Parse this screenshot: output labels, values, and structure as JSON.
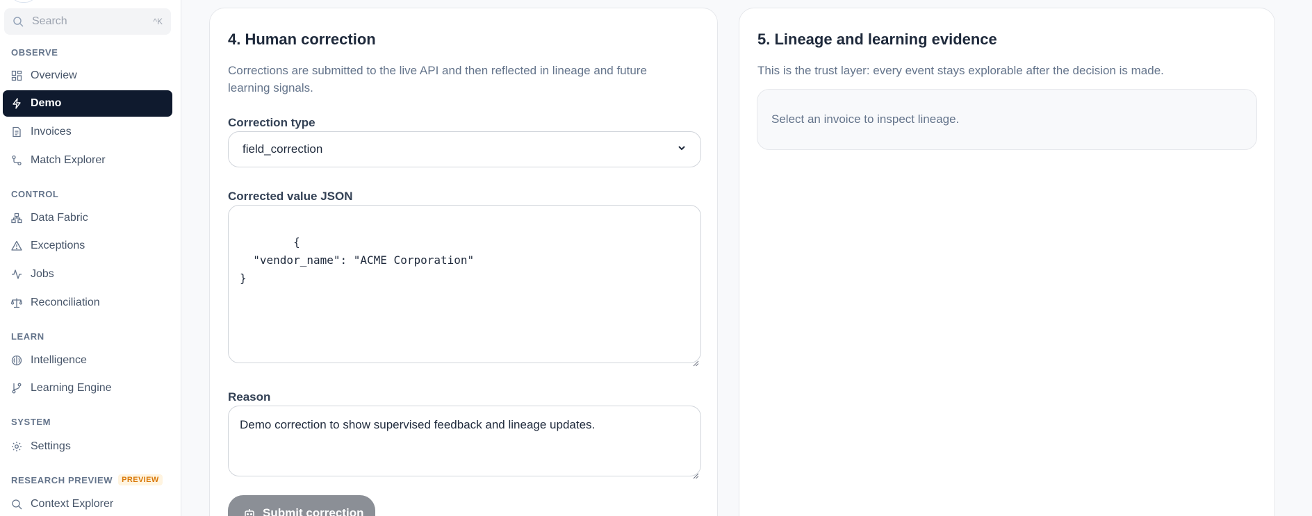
{
  "sidebar": {
    "search": {
      "placeholder": "Search",
      "shortcut": "^K"
    },
    "sections": [
      {
        "label": "OBSERVE",
        "items": [
          {
            "label": "Overview",
            "icon": "grid-icon",
            "active": false
          },
          {
            "label": "Demo",
            "icon": "zap-icon",
            "active": true
          },
          {
            "label": "Invoices",
            "icon": "file-icon",
            "active": false
          },
          {
            "label": "Match Explorer",
            "icon": "route-icon",
            "active": false
          }
        ]
      },
      {
        "label": "CONTROL",
        "items": [
          {
            "label": "Data Fabric",
            "icon": "network-icon",
            "active": false
          },
          {
            "label": "Exceptions",
            "icon": "warning-icon",
            "active": false
          },
          {
            "label": "Jobs",
            "icon": "activity-icon",
            "active": false
          },
          {
            "label": "Reconciliation",
            "icon": "scale-icon",
            "active": false
          }
        ]
      },
      {
        "label": "LEARN",
        "items": [
          {
            "label": "Intelligence",
            "icon": "brain-icon",
            "active": false
          },
          {
            "label": "Learning Engine",
            "icon": "branch-icon",
            "active": false
          }
        ]
      },
      {
        "label": "SYSTEM",
        "items": [
          {
            "label": "Settings",
            "icon": "gear-icon",
            "active": false
          }
        ]
      },
      {
        "label": "RESEARCH PREVIEW",
        "badge": "PREVIEW",
        "items": [
          {
            "label": "Context Explorer",
            "icon": "search-icon",
            "active": false
          }
        ]
      }
    ]
  },
  "correction": {
    "title": "4. Human correction",
    "description_line1": "Corrections are submitted to the live API and then reflected in lineage and future",
    "description_line2": "learning signals.",
    "type_label": "Correction type",
    "type_value": "field_correction",
    "json_label": "Corrected value JSON",
    "json_value": "{\n  \"vendor_name\": \"ACME Corporation\"\n}",
    "reason_label": "Reason",
    "reason_value": "Demo correction to show supervised feedback and lineage updates.",
    "submit_label": "Submit correction"
  },
  "lineage": {
    "title": "5. Lineage and learning evidence",
    "description": "This is the trust layer: every event stays explorable after the decision is made.",
    "empty_text": "Select an invoice to inspect lineage."
  },
  "colors": {
    "active_bg": "#0f1a2e",
    "preview_badge": "#d97706",
    "submit_disabled": "#8b8f96"
  }
}
